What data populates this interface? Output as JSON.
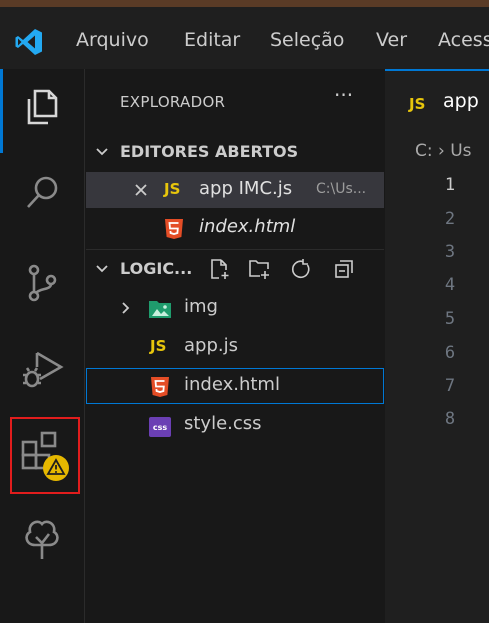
{
  "menubar": {
    "items": [
      "Arquivo",
      "Editar",
      "Seleção",
      "Ver",
      "Acess"
    ]
  },
  "activity": {
    "items": [
      "explorer-icon",
      "search-icon",
      "source-control-icon",
      "run-debug-icon",
      "extensions-icon",
      "tree-icon"
    ]
  },
  "sidebar": {
    "title": "EXPLORADOR",
    "more": "···",
    "open_editors": {
      "header": "EDITORES ABERTOS",
      "items": [
        {
          "badge": "JS",
          "name": "app IMC.js",
          "path": "C:\\Us..."
        },
        {
          "name": "index.html"
        }
      ]
    },
    "folder": {
      "header": "LOGIC...",
      "items": [
        {
          "name": "img"
        },
        {
          "badge": "JS",
          "name": "app.js"
        },
        {
          "name": "index.html"
        },
        {
          "badge": "css",
          "name": "style.css"
        }
      ]
    }
  },
  "editor": {
    "tab": {
      "badge": "JS",
      "name": "app"
    },
    "breadcrumb": "C: › Us",
    "line_numbers": [
      "1",
      "2",
      "3",
      "4",
      "5",
      "6",
      "7",
      "8"
    ]
  },
  "colors": {
    "accent": "#0078d4",
    "js_yellow": "#e8c60c",
    "html_orange": "#e44d26",
    "css_purple": "#6b3fb4",
    "highlight_red": "#e11d1d",
    "warning_yellow": "#e6b800"
  }
}
